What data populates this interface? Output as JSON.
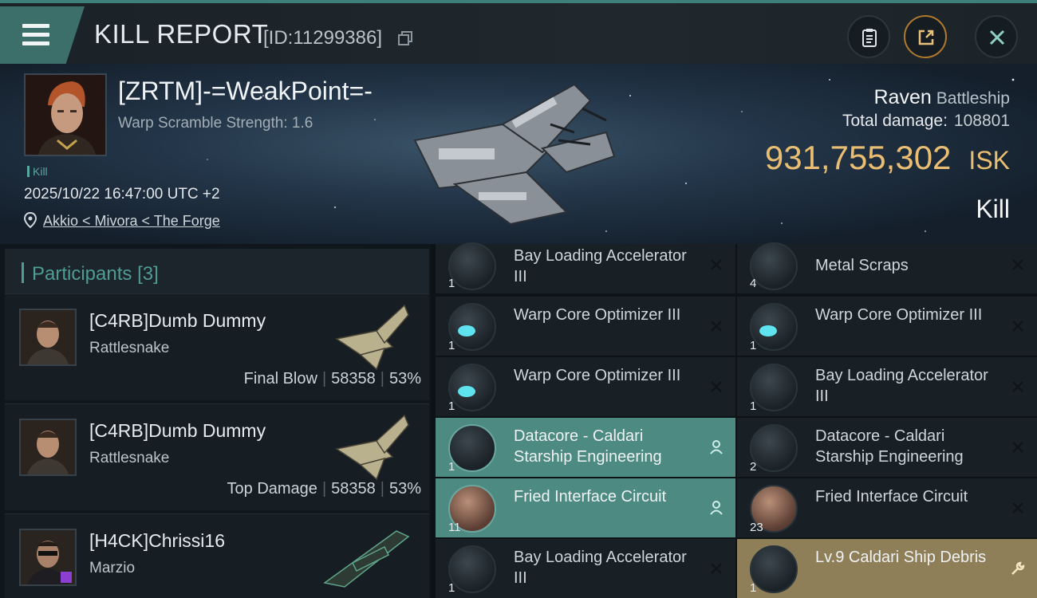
{
  "header": {
    "title": "KILL REPORT",
    "report_id": "[ID:11299386]"
  },
  "victim": {
    "name": "[ZRTM]-=WeakPoint=-",
    "warp_scramble": "Warp Scramble Strength: 1.6",
    "tag": "Kill",
    "datetime": "2025/10/22 16:47:00 UTC +2",
    "location": "Akkio < Mivora < The Forge",
    "ship_name": "Raven",
    "ship_class": "Battleship",
    "total_damage_label": "Total damage:",
    "total_damage": "108801",
    "isk_value": "931,755,302",
    "isk_unit": "ISK",
    "result": "Kill"
  },
  "participants": {
    "label": "Participants",
    "count": "[3]",
    "list": [
      {
        "name": "[C4RB]Dumb Dummy",
        "ship": "Rattlesnake",
        "role": "Final Blow",
        "damage": "58358",
        "percent": "53%"
      },
      {
        "name": "[C4RB]Dumb Dummy",
        "ship": "Rattlesnake",
        "role": "Top Damage",
        "damage": "58358",
        "percent": "53%"
      },
      {
        "name": "[H4CK]Chrissi16",
        "ship": "Marzio",
        "role": "",
        "damage": "",
        "percent": ""
      }
    ]
  },
  "items": [
    {
      "name": "Bay Loading Accelerator III",
      "qty": "1",
      "state": "destroyed"
    },
    {
      "name": "Metal Scraps",
      "qty": "4",
      "state": "destroyed"
    },
    {
      "name": "Warp Core Optimizer III",
      "qty": "1",
      "state": "destroyed"
    },
    {
      "name": "Warp Core Optimizer III",
      "qty": "1",
      "state": "destroyed"
    },
    {
      "name": "Warp Core Optimizer III",
      "qty": "1",
      "state": "destroyed"
    },
    {
      "name": "Bay Loading Accelerator III",
      "qty": "1",
      "state": "destroyed"
    },
    {
      "name": "Datacore - Caldari Starship Engineering",
      "qty": "1",
      "state": "dropped"
    },
    {
      "name": "Datacore - Caldari Starship Engineering",
      "qty": "2",
      "state": "destroyed"
    },
    {
      "name": "Fried Interface Circuit",
      "qty": "11",
      "state": "dropped"
    },
    {
      "name": "Fried Interface Circuit",
      "qty": "23",
      "state": "destroyed"
    },
    {
      "name": "Bay Loading Accelerator III",
      "qty": "1",
      "state": "destroyed"
    },
    {
      "name": "Lv.9 Caldari Ship Debris",
      "qty": "1",
      "state": "salvage"
    }
  ],
  "colors": {
    "accent": "#4f9c94",
    "isk": "#e9be72",
    "dropped": "#4c8a82",
    "salvage": "#8f7f59"
  }
}
